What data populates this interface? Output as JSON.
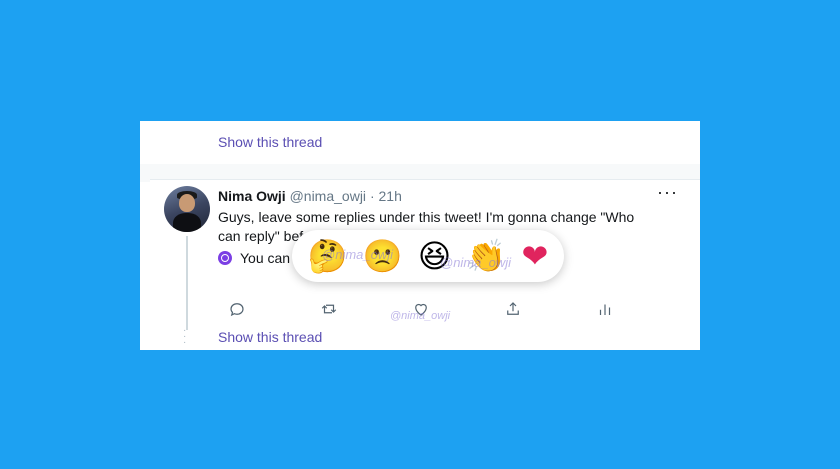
{
  "thread": {
    "show_thread_top": "Show this thread",
    "show_thread_bottom": "Show this thread"
  },
  "tweet": {
    "author_name": "Nima Owji",
    "author_handle": "@nima_owji",
    "separator": "·",
    "time": "21h",
    "more_label": "···",
    "text": "Guys, leave some replies under this tweet! I'm gonna change \"Who can reply\" before releasi...",
    "reply_notice": "You can"
  },
  "reactions": [
    {
      "name": "thinking",
      "glyph": "🤔"
    },
    {
      "name": "sad",
      "glyph": "🙁"
    },
    {
      "name": "laughing",
      "glyph": "😆"
    },
    {
      "name": "clapping",
      "glyph": "👏"
    },
    {
      "name": "heart",
      "glyph": "❤"
    }
  ],
  "watermark": "@nima_owji",
  "icons": [
    "reply-icon",
    "retweet-icon",
    "like-icon",
    "share-icon",
    "analytics-icon"
  ],
  "colors": {
    "background": "#1da1f2",
    "link": "#5b4fb3",
    "notice_icon": "#7b3fe4"
  }
}
